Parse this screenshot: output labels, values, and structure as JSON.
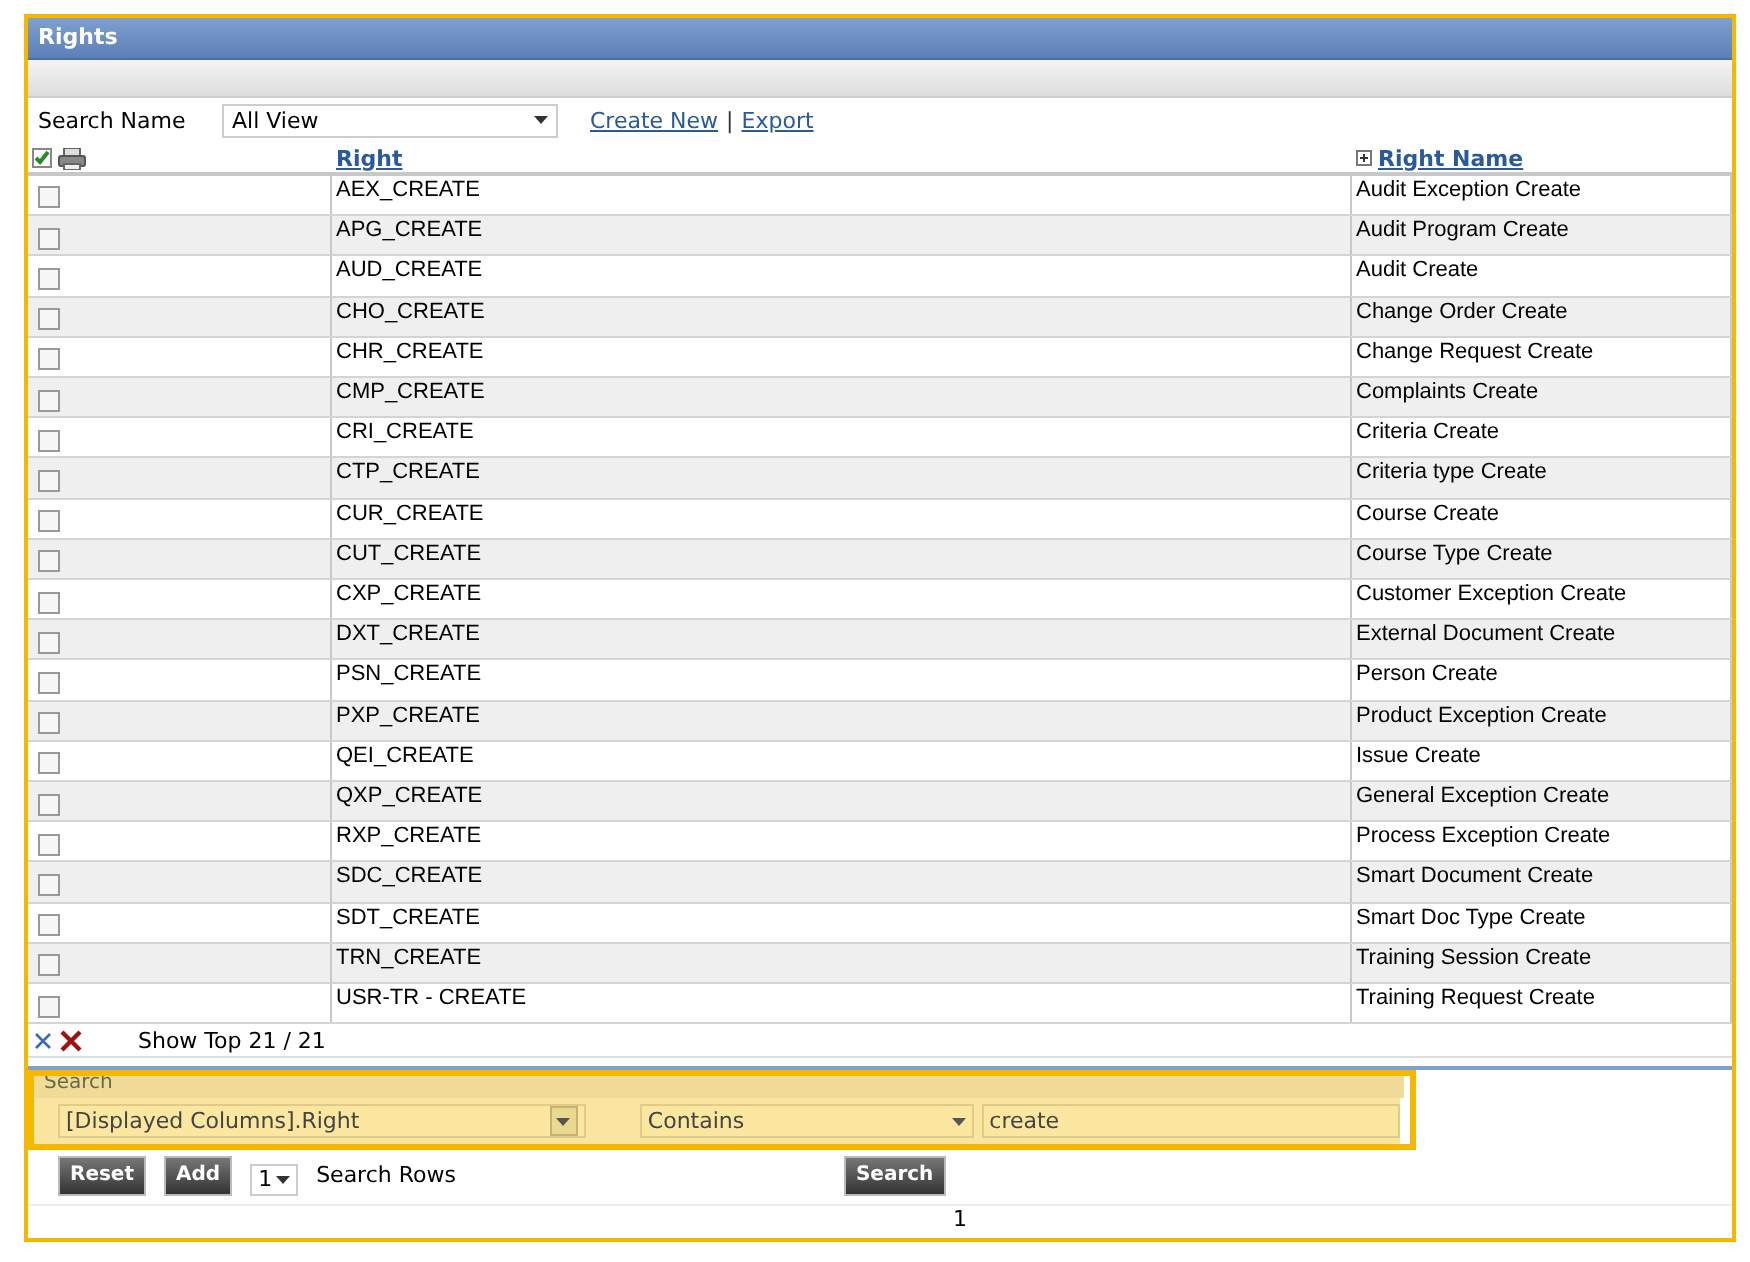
{
  "window": {
    "title": "Rights"
  },
  "toolbar": {
    "search_name_label": "Search Name",
    "view_select": "All View",
    "links": [
      "Create New",
      "Export"
    ],
    "separator": "|"
  },
  "table": {
    "columns": [
      "Right",
      "Right Name"
    ],
    "rows": [
      {
        "right": "AEX_CREATE",
        "name": "Audit Exception Create",
        "checked": false
      },
      {
        "right": "APG_CREATE",
        "name": "Audit Program Create",
        "checked": false
      },
      {
        "right": "AUD_CREATE",
        "name": "Audit Create",
        "checked": false
      },
      {
        "right": "CHO_CREATE",
        "name": "Change Order Create",
        "checked": false
      },
      {
        "right": "CHR_CREATE",
        "name": "Change Request Create",
        "checked": false
      },
      {
        "right": "CMP_CREATE",
        "name": "Complaints Create",
        "checked": false
      },
      {
        "right": "CRI_CREATE",
        "name": "Criteria Create",
        "checked": false
      },
      {
        "right": "CTP_CREATE",
        "name": "Criteria type Create",
        "checked": false
      },
      {
        "right": "CUR_CREATE",
        "name": "Course Create",
        "checked": false
      },
      {
        "right": "CUT_CREATE",
        "name": "Course Type Create",
        "checked": false
      },
      {
        "right": "CXP_CREATE",
        "name": "Customer Exception Create",
        "checked": false
      },
      {
        "right": "DXT_CREATE",
        "name": "External Document Create",
        "checked": false
      },
      {
        "right": "PSN_CREATE",
        "name": "Person Create",
        "checked": false
      },
      {
        "right": "PXP_CREATE",
        "name": "Product Exception Create",
        "checked": false
      },
      {
        "right": "QEI_CREATE",
        "name": "Issue Create",
        "checked": false
      },
      {
        "right": "QXP_CREATE",
        "name": "General Exception Create",
        "checked": false
      },
      {
        "right": "RXP_CREATE",
        "name": "Process Exception Create",
        "checked": false
      },
      {
        "right": "SDC_CREATE",
        "name": "Smart Document Create",
        "checked": false
      },
      {
        "right": "SDT_CREATE",
        "name": "Smart Doc Type Create",
        "checked": false
      },
      {
        "right": "TRN_CREATE",
        "name": "Training Session Create",
        "checked": false
      },
      {
        "right": "USR-TR - CREATE",
        "name": "Training Request Create",
        "checked": false
      }
    ],
    "footer": "Show Top 21 / 21"
  },
  "search": {
    "title": "Search",
    "field": "[Displayed Columns].Right",
    "operator": "Contains",
    "value": "create",
    "rows_count": "1",
    "rows_label": "Search Rows",
    "buttons": [
      "Reset",
      "Add",
      "Search"
    ]
  },
  "pager": {
    "page": "1"
  }
}
